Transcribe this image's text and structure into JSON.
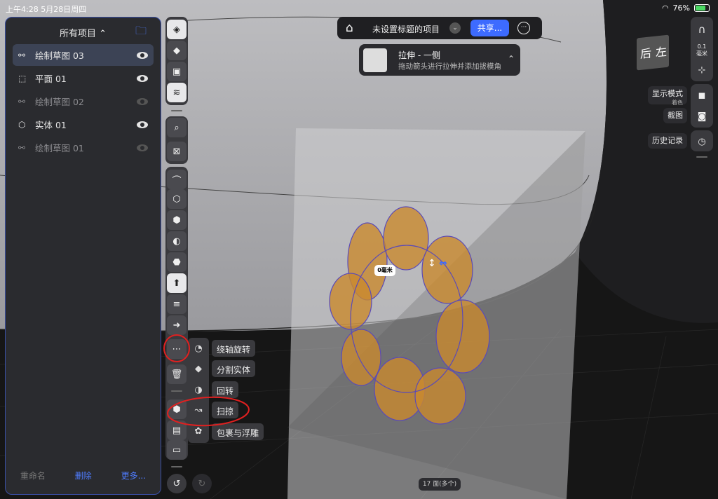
{
  "status": {
    "time": "上午4:28  5月28日周四",
    "battery": "76%"
  },
  "panel": {
    "title": "所有项目 ⌃",
    "items": [
      {
        "icon": "sketch-icon",
        "label": "绘制草图 03",
        "selected": true,
        "visible": true
      },
      {
        "icon": "plane-icon",
        "label": "平面  01",
        "selected": false,
        "visible": true
      },
      {
        "icon": "sketch-icon",
        "label": "绘制草图 02",
        "selected": false,
        "visible": false
      },
      {
        "icon": "solid-icon",
        "label": "实体  01",
        "selected": false,
        "visible": true
      },
      {
        "icon": "sketch-icon",
        "label": "绘制草图 01",
        "selected": false,
        "visible": false
      }
    ],
    "footer": {
      "rename": "重命名",
      "delete": "删除",
      "more": "更多..."
    }
  },
  "topbar": {
    "title": "未设置标题的项目",
    "share": "共享..."
  },
  "hint": {
    "title": "拉伸 - 一侧",
    "desc": "拖动箭头进行拉伸并添加拔模角"
  },
  "flyout": {
    "revolve_axis": "绕轴旋转",
    "split": "分割实体",
    "revolve": "回转",
    "sweep": "扫掠",
    "wrap": "包裹与浮雕"
  },
  "right": {
    "snap_value": "0.1",
    "snap_unit": "毫米",
    "display_mode": "显示模式",
    "display_sub": "着色",
    "screenshot": "截图",
    "history": "历史记录",
    "cube_back": "后",
    "cube_left": "左"
  },
  "viewport": {
    "dimension": "0毫米",
    "faces": "17 面(多个)"
  },
  "colors": {
    "accent": "#3d6bff",
    "shape_fill": "#c98a2e"
  }
}
